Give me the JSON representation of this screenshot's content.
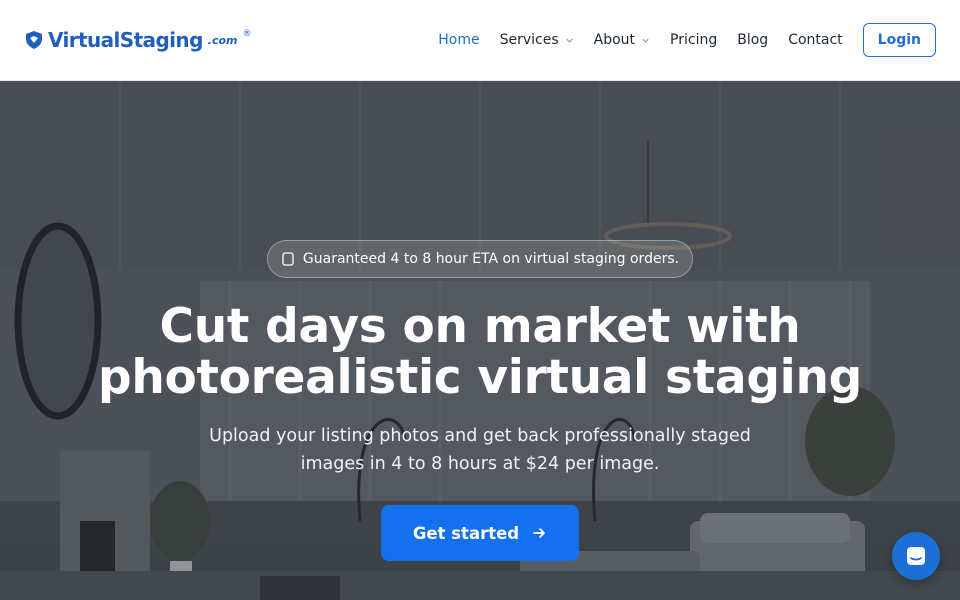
{
  "brand": {
    "name": "VirtualStaging",
    "suffix": ".com",
    "reg": "®",
    "color": "#1f5fbf"
  },
  "nav": {
    "items": [
      {
        "label": "Home",
        "active": true,
        "dropdown": false
      },
      {
        "label": "Services",
        "active": false,
        "dropdown": true
      },
      {
        "label": "About",
        "active": false,
        "dropdown": true
      },
      {
        "label": "Pricing",
        "active": false,
        "dropdown": false
      },
      {
        "label": "Blog",
        "active": false,
        "dropdown": false
      },
      {
        "label": "Contact",
        "active": false,
        "dropdown": false
      }
    ],
    "login_label": "Login",
    "accent": "#1d6fd8"
  },
  "hero": {
    "badge_icon": "clock-icon",
    "badge_text": "Guaranteed 4 to 8 hour ETA on virtual staging orders.",
    "headline_line1": "Cut days on market with",
    "headline_line2": "photorealistic virtual staging",
    "subhead": "Upload your listing photos and get back professionally staged images in 4 to 8 hours at $24 per image.",
    "cta_label": "Get started",
    "cta_color": "#1570ef"
  },
  "chat": {
    "icon": "chat-icon"
  }
}
